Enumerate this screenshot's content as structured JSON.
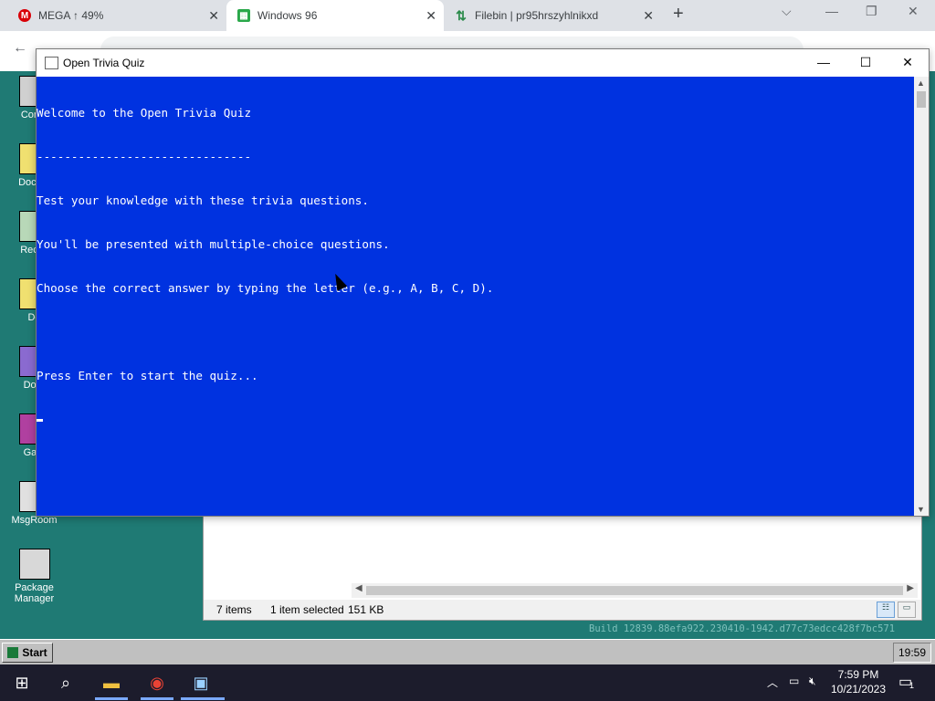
{
  "browser": {
    "tabs": [
      {
        "title": "MEGA ↑ 49%",
        "favicon": "mega-icon"
      },
      {
        "title": "Windows 96",
        "favicon": "windows96-icon",
        "active": true
      },
      {
        "title": "Filebin | pr95hrszyhlnikxd",
        "favicon": "filebin-icon"
      }
    ]
  },
  "desktop": {
    "icons": [
      {
        "label": "Comp",
        "icon": "computer-icon"
      },
      {
        "label": "Docum",
        "icon": "documents-icon"
      },
      {
        "label": "Recyc",
        "icon": "recycle-bin-icon"
      },
      {
        "label": "Do",
        "icon": "folder-icon"
      },
      {
        "label": "Door",
        "icon": "doom-icon"
      },
      {
        "label": "Gam",
        "icon": "games-icon"
      },
      {
        "label": "MsgRoom",
        "icon": "msgroom-icon"
      },
      {
        "label": "Package Manager",
        "icon": "package-manager-icon"
      }
    ],
    "build": "Build 12839.88efa922.230410-1942.d77c73edcc428f7bc571"
  },
  "explorer": {
    "status": {
      "items": "7 items",
      "selected": "1 item selected",
      "size": "151 KB"
    }
  },
  "console_window": {
    "title": "Open Trivia Quiz",
    "lines": [
      "Welcome to the Open Trivia Quiz",
      "-------------------------------",
      "Test your knowledge with these trivia questions.",
      "You'll be presented with multiple-choice questions.",
      "Choose the correct answer by typing the letter (e.g., A, B, C, D).",
      "",
      "Press Enter to start the quiz..."
    ],
    "background": "#0032e0"
  },
  "w96_taskbar": {
    "start_label": "Start",
    "clock": "19:59"
  },
  "host_taskbar": {
    "time": "7:59 PM",
    "date": "10/21/2023",
    "notification_count": "1"
  }
}
